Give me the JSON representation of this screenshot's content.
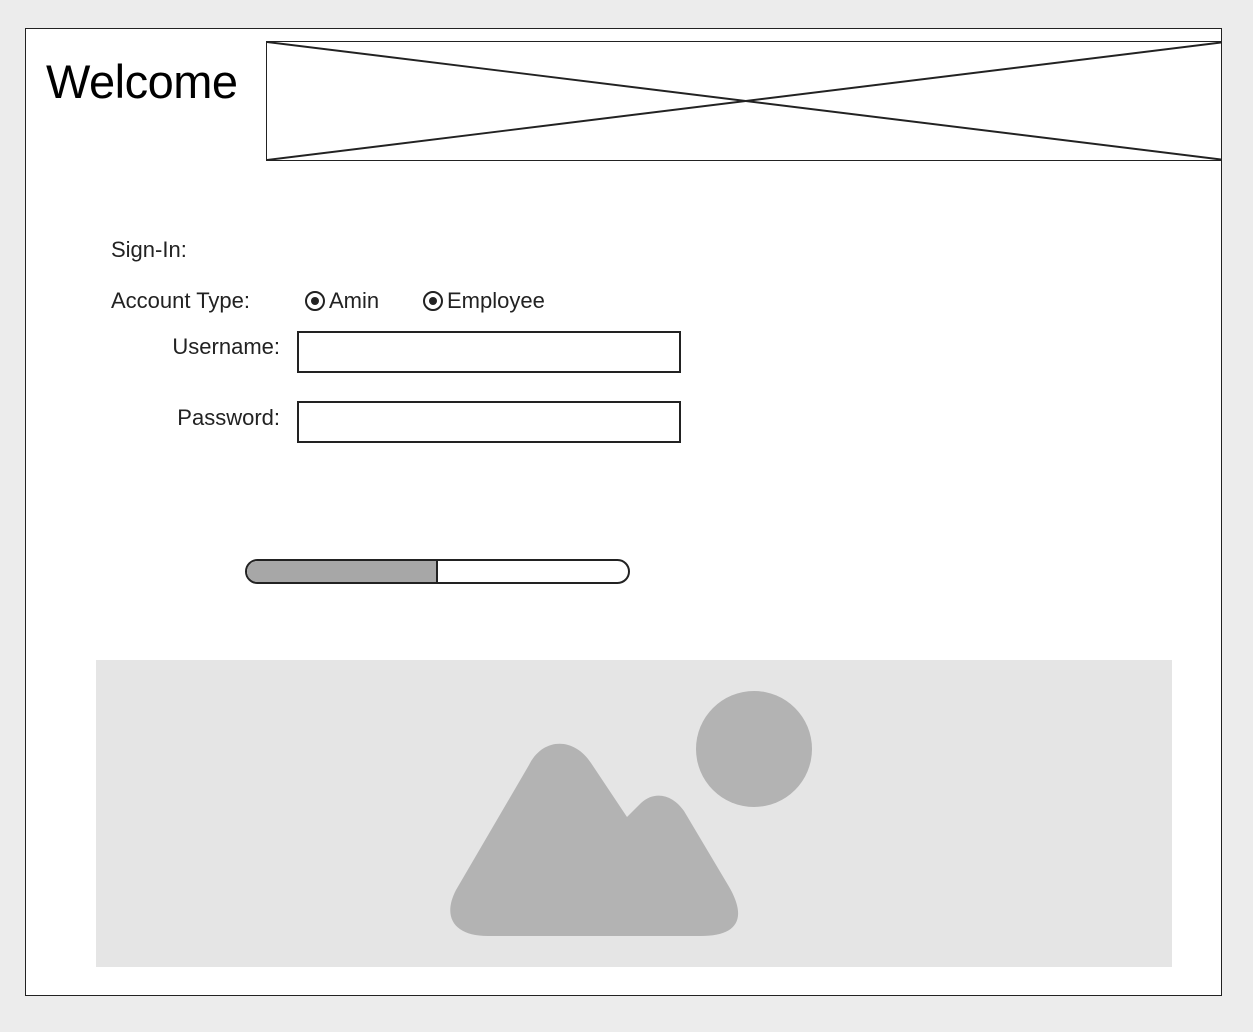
{
  "page": {
    "title": "Welcome",
    "sign_in_label": "Sign-In:"
  },
  "account_type": {
    "label": "Account Type:",
    "options": [
      {
        "label": "Amin",
        "selected": true
      },
      {
        "label": "Employee",
        "selected": true
      }
    ]
  },
  "fields": {
    "username_label": "Username:",
    "username_value": "",
    "password_label": "Password:",
    "password_value": ""
  },
  "progress": {
    "value_percent": 50
  },
  "images": {
    "banner_placeholder_icon": "crossed-box-icon",
    "bottom_placeholder_icon": "landscape-image-icon"
  },
  "colors": {
    "background": "#ececec",
    "frame_fill": "#ffffff",
    "outline": "#222222",
    "progress_fill": "#a7a7a7",
    "image_placeholder_fill": "#e5e5e5",
    "image_placeholder_icon": "#b3b3b3"
  }
}
